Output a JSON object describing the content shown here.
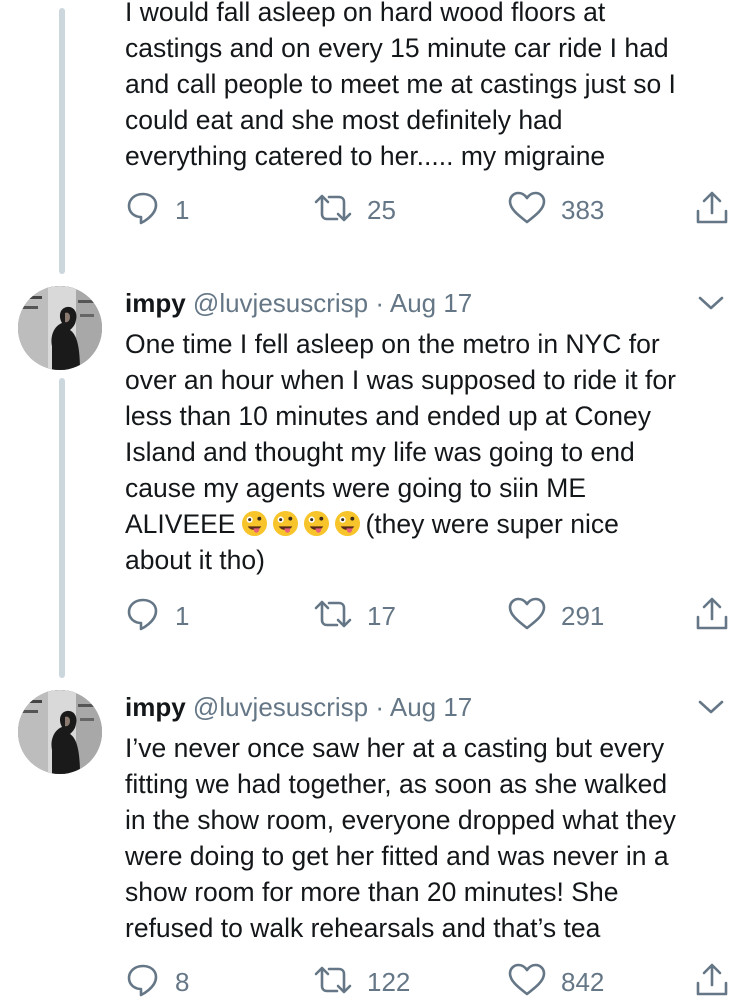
{
  "tweets": [
    {
      "text": "I would fall asleep on hard wood floors at\ncastings and on every 15 minute car ride I had\nand call people to meet me at castings just so I\ncould eat and she most definitely had\neverything catered to her..... my migraine",
      "replies": "1",
      "retweets": "25",
      "likes": "383"
    },
    {
      "name": "impy",
      "handle": "@luvjesuscrisp",
      "separator": "·",
      "date": "Aug 17",
      "text": "One time I fell asleep on the metro in NYC for\nover an hour when I was supposed to ride it for\nless than 10 minutes and ended up at Coney\nIsland and thought my life was going to end\ncause my agents were going to siin ME\nALIVEEE",
      "text_after_emoji": "(they were super nice\nabout it tho)",
      "emoji": [
        "zany-face",
        "zany-face",
        "zany-face",
        "zany-face"
      ],
      "replies": "1",
      "retweets": "17",
      "likes": "291"
    },
    {
      "name": "impy",
      "handle": "@luvjesuscrisp",
      "separator": "·",
      "date": "Aug 17",
      "text": "I’ve never once saw her at a casting but every\nfitting we had together, as soon as she walked\nin the show room, everyone dropped what they\nwere doing to get her fitted and was never in a\nshow room for more than 20 minutes! She\nrefused to walk rehearsals and that’s tea",
      "replies": "8",
      "retweets": "122",
      "likes": "842"
    }
  ],
  "icons": {
    "reply": "reply-icon",
    "retweet": "retweet-icon",
    "like": "heart-icon",
    "share": "share-icon",
    "more": "chevron-down-icon"
  },
  "colors": {
    "text": "#14171a",
    "secondary": "#657786",
    "thread_line": "#ccd6dd"
  }
}
